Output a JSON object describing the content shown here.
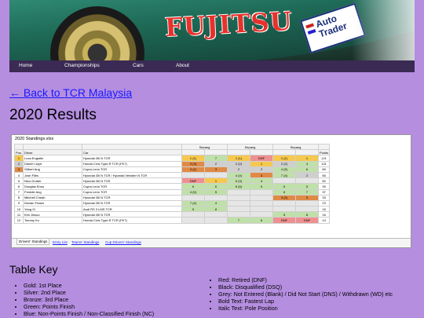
{
  "banner": {
    "logo_text": "FUJITSU",
    "sponsor_line1": "Auto",
    "sponsor_line2": "Trader"
  },
  "nav": {
    "items": [
      "Home",
      "Championships",
      "Cars",
      "About"
    ]
  },
  "back_link": "← Back to TCR Malaysia",
  "page_title": "2020 Results",
  "sheet": {
    "filename": "2020 Standings.xlsx",
    "headers": {
      "pos": "Pos.",
      "driver": "Driver",
      "car": "Car",
      "round1": "Sepang",
      "round2": "Sepang",
      "round3": "Sepang",
      "points": "Points"
    },
    "rows": [
      {
        "pos": "1",
        "driver": "Luca Engstler",
        "car": "Hyundai i30 N TCR",
        "r": [
          "1 (1)",
          "7",
          "1 (1)",
          "DNF",
          "1 (1)",
          "1"
        ],
        "cls": [
          "gold",
          "green",
          "gold",
          "red",
          "gold",
          "gold"
        ],
        "pts": "121"
      },
      {
        "pos": "2",
        "driver": "Daniel Lloyd",
        "car": "Honda Civic Type-R TCR (FK7)",
        "r": [
          "3 (3)",
          "2",
          "2 (2)",
          "1",
          "2 (2)",
          "4"
        ],
        "cls": [
          "bronze",
          "silver",
          "silver",
          "gold",
          "silver",
          "green"
        ],
        "pts": "121"
      },
      {
        "pos": "3",
        "driver": "Gilbert Ang",
        "car": "Cupra León TCR",
        "r": [
          "3 (2)",
          "3",
          "2",
          "2",
          "4 (5)",
          "6"
        ],
        "cls": [
          "bronze",
          "bronze",
          "silver",
          "silver",
          "green",
          "green"
        ],
        "pts": "89"
      },
      {
        "pos": "4",
        "driver": "Josh Files",
        "car": "Hyundai i30 N TCR / Hyundai Veloster N TCR",
        "r": [
          "",
          "",
          "4 (4)",
          "3",
          "7 (4)",
          "2"
        ],
        "cls": [
          "grey",
          "grey",
          "green",
          "bronze",
          "green",
          "silver"
        ],
        "pts": "56"
      },
      {
        "pos": "5",
        "driver": "Nico Gruber",
        "car": "Hyundai i30 N TCR",
        "r": [
          "DNF",
          "1",
          "5 (3)",
          "4",
          "",
          ""
        ],
        "cls": [
          "red",
          "gold",
          "green",
          "green",
          "grey",
          "grey"
        ],
        "pts": "50"
      },
      {
        "pos": "6",
        "driver": "Douglas Khoo",
        "car": "Cupra León TCR",
        "r": [
          "6",
          "6",
          "6 (5)",
          "5",
          "5",
          "5"
        ],
        "cls": [
          "green",
          "green",
          "green",
          "green",
          "green",
          "green"
        ],
        "pts": "39"
      },
      {
        "pos": "7",
        "driver": "Freddie Ang",
        "car": "Cupra León TCR",
        "r": [
          "4 (5)",
          "5",
          "",
          "",
          "6",
          "7"
        ],
        "cls": [
          "green",
          "green",
          "grey",
          "grey",
          "green",
          "green"
        ],
        "pts": "37"
      },
      {
        "pos": "8",
        "driver": "Mitchell Cheah",
        "car": "Hyundai i30 N TCR",
        "r": [
          "",
          "",
          "",
          "",
          "3 (3)",
          "3"
        ],
        "cls": [
          "grey",
          "grey",
          "grey",
          "grey",
          "bronze",
          "bronze"
        ],
        "pts": "33"
      },
      {
        "pos": "9",
        "driver": "Declan Fraser",
        "car": "Hyundai i30 N TCR",
        "r": [
          "7 (4)",
          "4",
          "",
          "",
          "",
          ""
        ],
        "cls": [
          "green",
          "green",
          "grey",
          "grey",
          "grey",
          "grey"
        ],
        "pts": "23"
      },
      {
        "pos": "10",
        "driver": "Yang Xi",
        "car": "Audi RS 3 LMS TCR",
        "r": [
          "5",
          "8",
          "",
          "",
          "",
          ""
        ],
        "cls": [
          "green",
          "green",
          "grey",
          "grey",
          "grey",
          "grey"
        ],
        "pts": "16"
      },
      {
        "pos": "11",
        "driver": "Kim Jinsoo",
        "car": "Hyundai i30 N TCR",
        "r": [
          "",
          "",
          "",
          "",
          "5",
          "8"
        ],
        "cls": [
          "grey",
          "grey",
          "grey",
          "grey",
          "green",
          "green"
        ],
        "pts": "16"
      },
      {
        "pos": "12",
        "driver": "Tommy Ku",
        "car": "Honda Civic Type-R TCR (FK7)",
        "r": [
          "",
          "",
          "7",
          "6",
          "DNF",
          "DNF"
        ],
        "cls": [
          "grey",
          "grey",
          "green",
          "green",
          "red",
          "red"
        ],
        "pts": "14"
      }
    ],
    "tabs": [
      "Drivers' Standings",
      "Entry List",
      "Teams' Standings",
      "Cup Drivers' Standings"
    ]
  },
  "key": {
    "title": "Table Key",
    "left": [
      "Gold: 1st Place",
      "Silver: 2nd Place",
      "Bronze: 3rd Place",
      "Green: Points Finish",
      "Blue: Non-Points Finish / Non-Classified Finish (NC)"
    ],
    "right": [
      "Red: Retired (DNF)",
      "Black: Disqualified (DSQ)",
      "Grey: Not Entered (Blank) / Did Not Start (DNS) / Withdrawn (WD) etc",
      "Bold Text: Fastest Lap",
      "Italic Text: Pole Position"
    ]
  }
}
